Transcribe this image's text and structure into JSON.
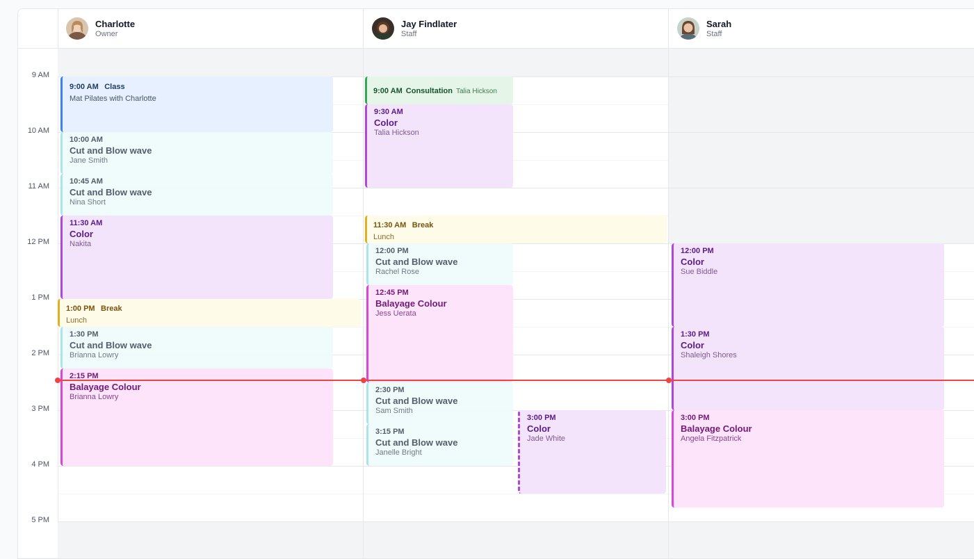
{
  "staff": [
    {
      "name": "Charlotte",
      "role": "Owner"
    },
    {
      "name": "Jay Findlater",
      "role": "Staff"
    },
    {
      "name": "Sarah",
      "role": "Staff"
    }
  ],
  "times": [
    "9 AM",
    "10 AM",
    "11 AM",
    "12 PM",
    "1 PM",
    "2 PM",
    "3 PM",
    "4 PM",
    "5 PM"
  ],
  "events": {
    "charlotte": [
      {
        "time": "9:00 AM",
        "label": "Class",
        "client": "Mat Pilates with Charlotte"
      },
      {
        "time": "10:00 AM",
        "service": "Cut and Blow wave",
        "client": "Jane Smith"
      },
      {
        "time": "10:45 AM",
        "service": "Cut and Blow wave",
        "client": "Nina Short"
      },
      {
        "time": "11:30 AM",
        "service": "Color",
        "client": "Nakita"
      },
      {
        "time": "1:00 PM",
        "label": "Break",
        "client": "Lunch"
      },
      {
        "time": "1:30 PM",
        "service": "Cut and Blow wave",
        "client": "Brianna Lowry"
      },
      {
        "time": "2:15 PM",
        "service": "Balayage Colour",
        "client": "Brianna Lowry"
      }
    ],
    "jay": [
      {
        "time": "9:00 AM",
        "label": "Consultation",
        "client": "Talia Hickson"
      },
      {
        "time": "9:30 AM",
        "service": "Color",
        "client": "Talia Hickson"
      },
      {
        "time": "11:30 AM",
        "label": "Break",
        "client": "Lunch"
      },
      {
        "time": "12:00 PM",
        "service": "Cut and Blow wave",
        "client": "Rachel Rose"
      },
      {
        "time": "12:45 PM",
        "service": "Balayage Colour",
        "client": "Jess Uerata"
      },
      {
        "time": "2:30 PM",
        "service": "Cut and Blow wave",
        "client": "Sam Smith"
      },
      {
        "time": "3:15 PM",
        "service": "Cut and Blow wave",
        "client": "Janelle Bright"
      },
      {
        "time": "3:00 PM",
        "service": "Color",
        "client": "Jade White"
      }
    ],
    "sarah": [
      {
        "time": "12:00 PM",
        "service": "Color",
        "client": "Sue Biddle"
      },
      {
        "time": "1:30 PM",
        "service": "Color",
        "client": "Shaleigh Shores"
      },
      {
        "time": "3:00 PM",
        "service": "Balayage Colour",
        "client": "Angela Fitzpatrick"
      }
    ]
  },
  "colors": {
    "class": "#3b82f6",
    "cut": "#a5e4ea",
    "color": "#b246d8",
    "balayage": "#d946d9",
    "break": "#e0b020",
    "consultation": "#34a853",
    "now_line": "#ef4444"
  }
}
